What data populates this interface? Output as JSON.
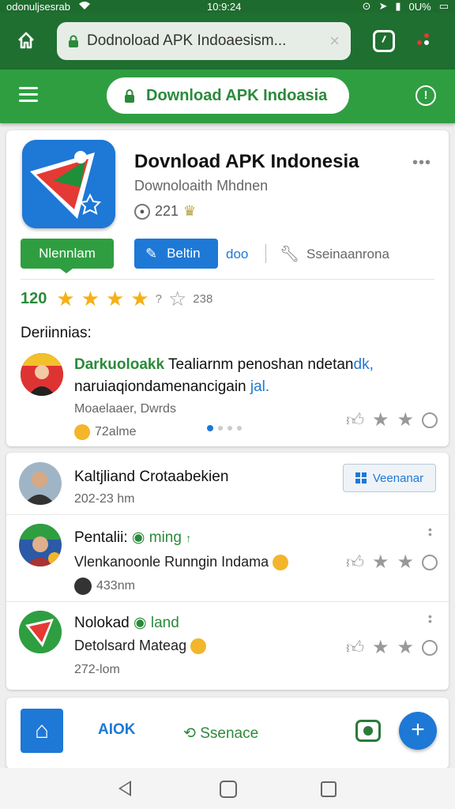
{
  "status_bar": {
    "left_text": "odonuljsesrab",
    "time": "10:9:24",
    "battery": "0U%"
  },
  "browser": {
    "url": "Dodnoload APK Indoaesism...",
    "close_symbol": "×"
  },
  "header": {
    "title": "Download APK Indoasia"
  },
  "app": {
    "title": "Dovnload APK Indonesia",
    "subtitle": "Downoloaith Mhdnen",
    "meta_number": "221",
    "more_symbol": "•••",
    "install_label": "Nlennlam",
    "open_label": "Beltin",
    "link_label": "doo",
    "settings_label": "Sseinaanrona"
  },
  "rating": {
    "value": "120",
    "question": "?",
    "count": "238",
    "filled_stars": 4
  },
  "section": {
    "label": "Deriinnias:"
  },
  "review": {
    "author_green": "Darkuoloakk",
    "line1_rest": "Tealiarnm penoshan ndetan",
    "line1_blue": "dk,",
    "line2_text": "naruiaqiondamenancigain",
    "line2_blue": "jal.",
    "line3": "Moaelaaer, Dwrds",
    "line4": "72alme"
  },
  "feed": [
    {
      "title": "Kaltjliand Crotaabekien",
      "meta": "202-23 hm",
      "button_label": "Veenanar"
    },
    {
      "title_prefix": "Pentalii:",
      "title_green": "ming",
      "title_arrow": "↑",
      "sub": "Vlenkanoonle Runngin Indama",
      "meta": "433nm"
    },
    {
      "title_prefix": "Nolokad",
      "title_green": "land",
      "sub": "Detolsard Mateag",
      "meta": "272-lom"
    }
  ],
  "bottom_bar": {
    "apk_label": "AIOK",
    "search_label": "Ssenace",
    "fab_symbol": "+"
  },
  "colors": {
    "browser_green": "#1f6f31",
    "header_green": "#2f9e41",
    "accent_blue": "#1e78d6",
    "star_gold": "#f5b014"
  }
}
